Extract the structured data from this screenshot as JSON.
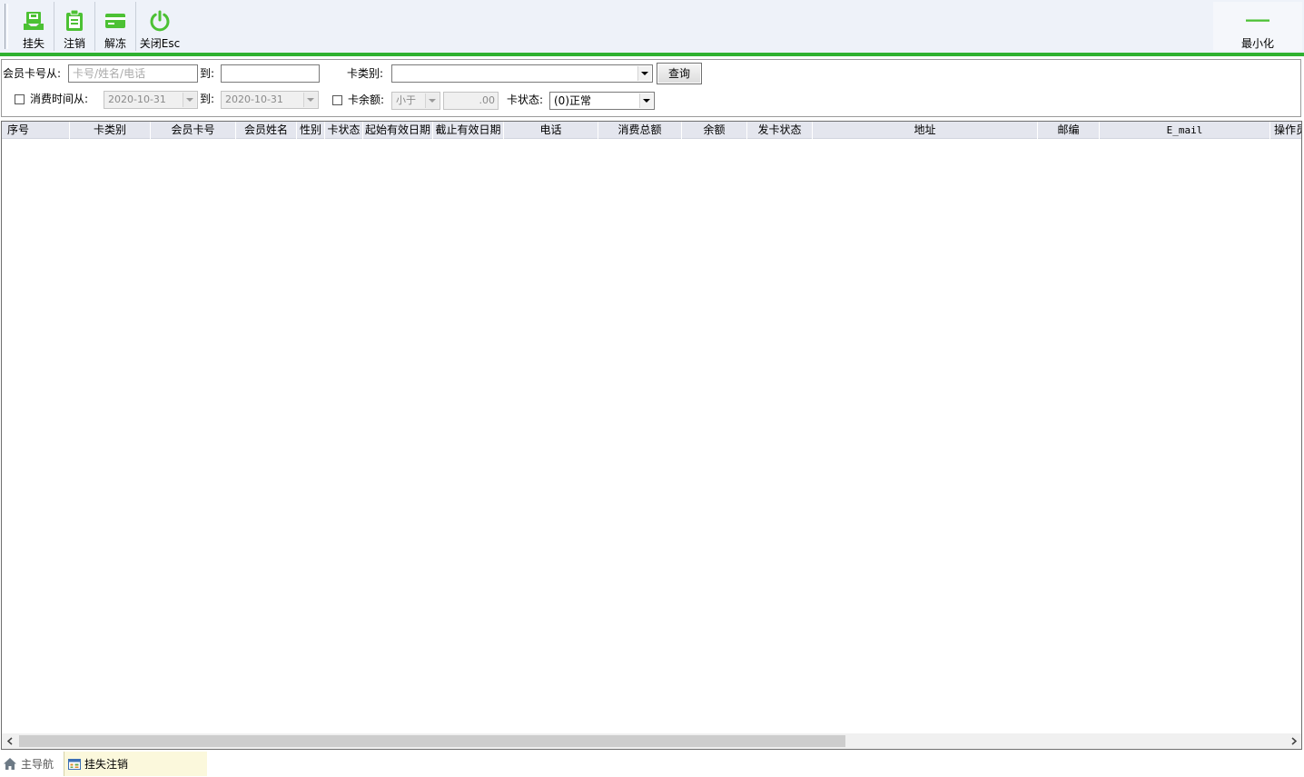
{
  "toolbar": {
    "buttons": [
      {
        "label": "挂失",
        "icon": "report-loss-icon"
      },
      {
        "label": "注销",
        "icon": "clipboard-cancel-icon"
      },
      {
        "label": "解冻",
        "icon": "card-unfreeze-icon"
      },
      {
        "label": "关闭Esc",
        "icon": "power-icon"
      }
    ],
    "minimize": {
      "label": "最小化",
      "icon": "minimize-icon"
    },
    "accent_color": "#2fb12f",
    "icon_color": "#4cc134"
  },
  "filter": {
    "card_from_label": "会员卡号从:",
    "card_from_placeholder": "卡号/姓名/电话",
    "card_to_label": "到:",
    "card_to_value": "",
    "card_type_label": "卡类别:",
    "card_type_value": "",
    "query_button": "查询",
    "spend_time_label": "消费时间从:",
    "spend_time_checked": false,
    "date_from": "2020-10-31",
    "date_to_label": "到:",
    "date_to": "2020-10-31",
    "balance_label": "卡余额:",
    "balance_checked": false,
    "balance_op": "小于",
    "balance_value": ".00",
    "card_status_label": "卡状态:",
    "card_status_value": "(0)正常"
  },
  "grid": {
    "columns": [
      "序号",
      "卡类别",
      "会员卡号",
      "会员姓名",
      "性别",
      "卡状态",
      "起始有效日期",
      "截止有效日期",
      "电话",
      "消费总额",
      "余额",
      "发卡状态",
      "地址",
      "邮编",
      "E_mail",
      "操作员"
    ],
    "rows": []
  },
  "tabs": [
    {
      "label": "主导航",
      "icon": "home-icon",
      "active": false
    },
    {
      "label": "挂失注销",
      "icon": "grid-window-icon",
      "active": true
    }
  ]
}
